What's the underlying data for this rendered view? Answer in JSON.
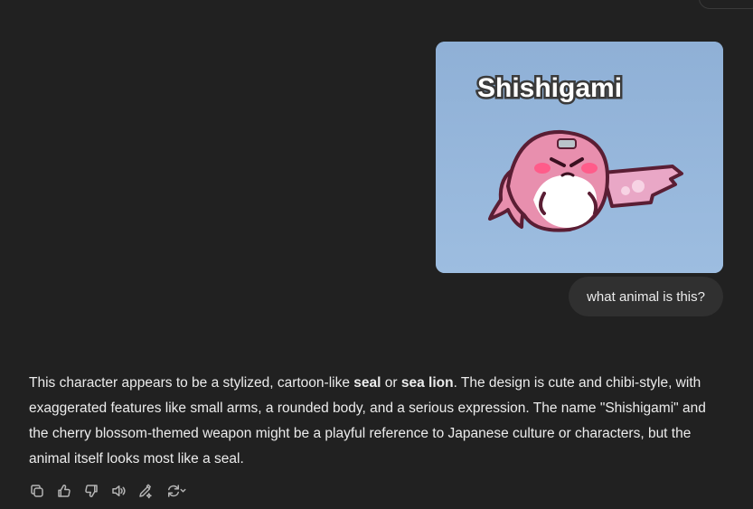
{
  "user_message": {
    "image_caption_text": "Shishigami",
    "text": "what animal is this?"
  },
  "assistant_message": {
    "p1": "This character appears to be a stylized, cartoon-like ",
    "b1": "seal",
    "p2": " or ",
    "b2": "sea lion",
    "p3": ". The design is cute and chibi-style, with exaggerated features like small arms, a rounded body, and a serious expression. The name \"Shishigami\" and the cherry blossom-themed weapon might be a playful reference to Japanese culture or characters, but the animal itself looks most like a seal."
  },
  "actions": {
    "icons": [
      "copy-icon",
      "thumbs-up-icon",
      "thumbs-down-icon",
      "read-aloud-icon",
      "edit-icon",
      "regenerate-icon"
    ]
  },
  "colors": {
    "background": "#212121",
    "bubble": "#303030",
    "text": "#ececec",
    "icon": "#b4b4b4",
    "image_bg": "#93b3d8",
    "character_pink": "#e88fae"
  }
}
